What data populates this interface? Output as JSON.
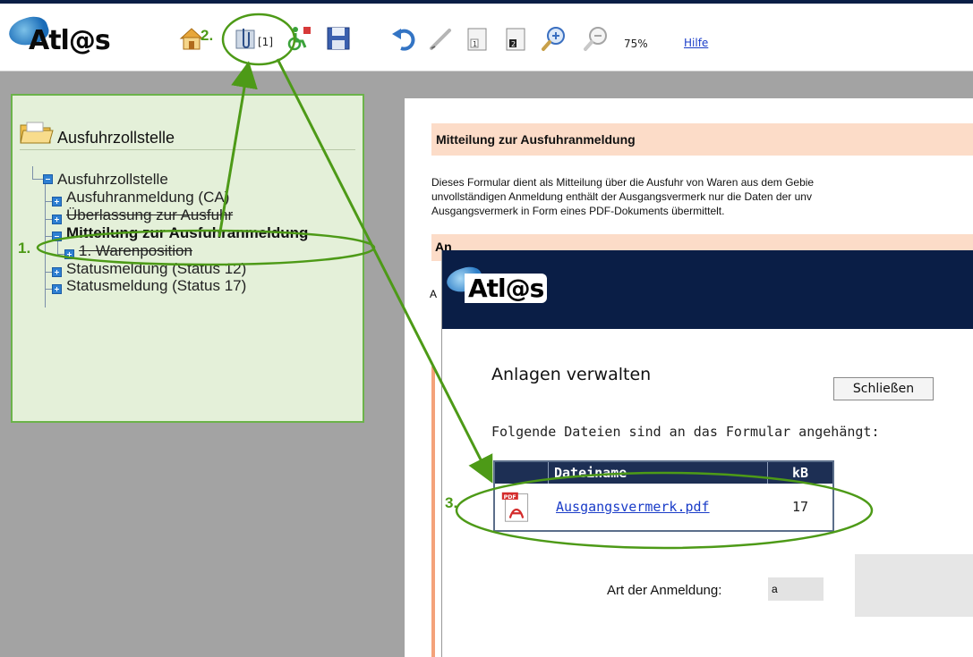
{
  "toolbar": {
    "logo_text": "Atl@s",
    "attachment_count": "[1]",
    "zoom": "75%",
    "help": "Hilfe",
    "icons": [
      "home-icon",
      "attachment-icon",
      "accessibility-icon",
      "save-icon",
      "undo-icon",
      "edit-icon",
      "page-1-icon",
      "page-2-icon",
      "zoom-in-icon",
      "zoom-out-icon"
    ]
  },
  "tree": {
    "title": "Ausfuhrzollstelle",
    "root": "Ausfuhrzollstelle",
    "items": [
      {
        "label": "Ausfuhranmeldung  (CA)"
      },
      {
        "label": "Überlassung zur Ausfuhr"
      },
      {
        "label": "Mitteilung zur Ausfuhranmeldung"
      },
      {
        "label": "1. Warenposition"
      },
      {
        "label": "Statusmeldung (Status 12)"
      },
      {
        "label": "Statusmeldung (Status 17)"
      }
    ]
  },
  "document": {
    "title": "Mitteilung zur Ausfuhranmeldung",
    "paragraph_lines": [
      "Dieses Formular dient als Mitteilung über die Ausfuhr von Waren aus dem Gebie",
      "unvollständigen Anmeldung enthält der Ausgangsvermerk nur die Daten der unv",
      "Ausgangsvermerk in Form eines PDF-Dokuments übermittelt."
    ],
    "section2_partial": "An",
    "left_partial": "A"
  },
  "popup": {
    "logo_text": "Atl@s",
    "title": "Anlagen verwalten",
    "close_label": "Schließen",
    "description": "Folgende Dateien sind an das Formular angehängt:",
    "table": {
      "headers": [
        "",
        "Dateiname",
        "kB"
      ],
      "rows": [
        {
          "icon": "pdf-icon",
          "filename": "Ausgangsvermerk.pdf",
          "size": "17"
        }
      ]
    },
    "art_label": "Art der Anmeldung:",
    "art_value": "a"
  },
  "annotations": {
    "step1": "1.",
    "step2": "2.",
    "step3": "3.",
    "color": "#4d9a17"
  }
}
